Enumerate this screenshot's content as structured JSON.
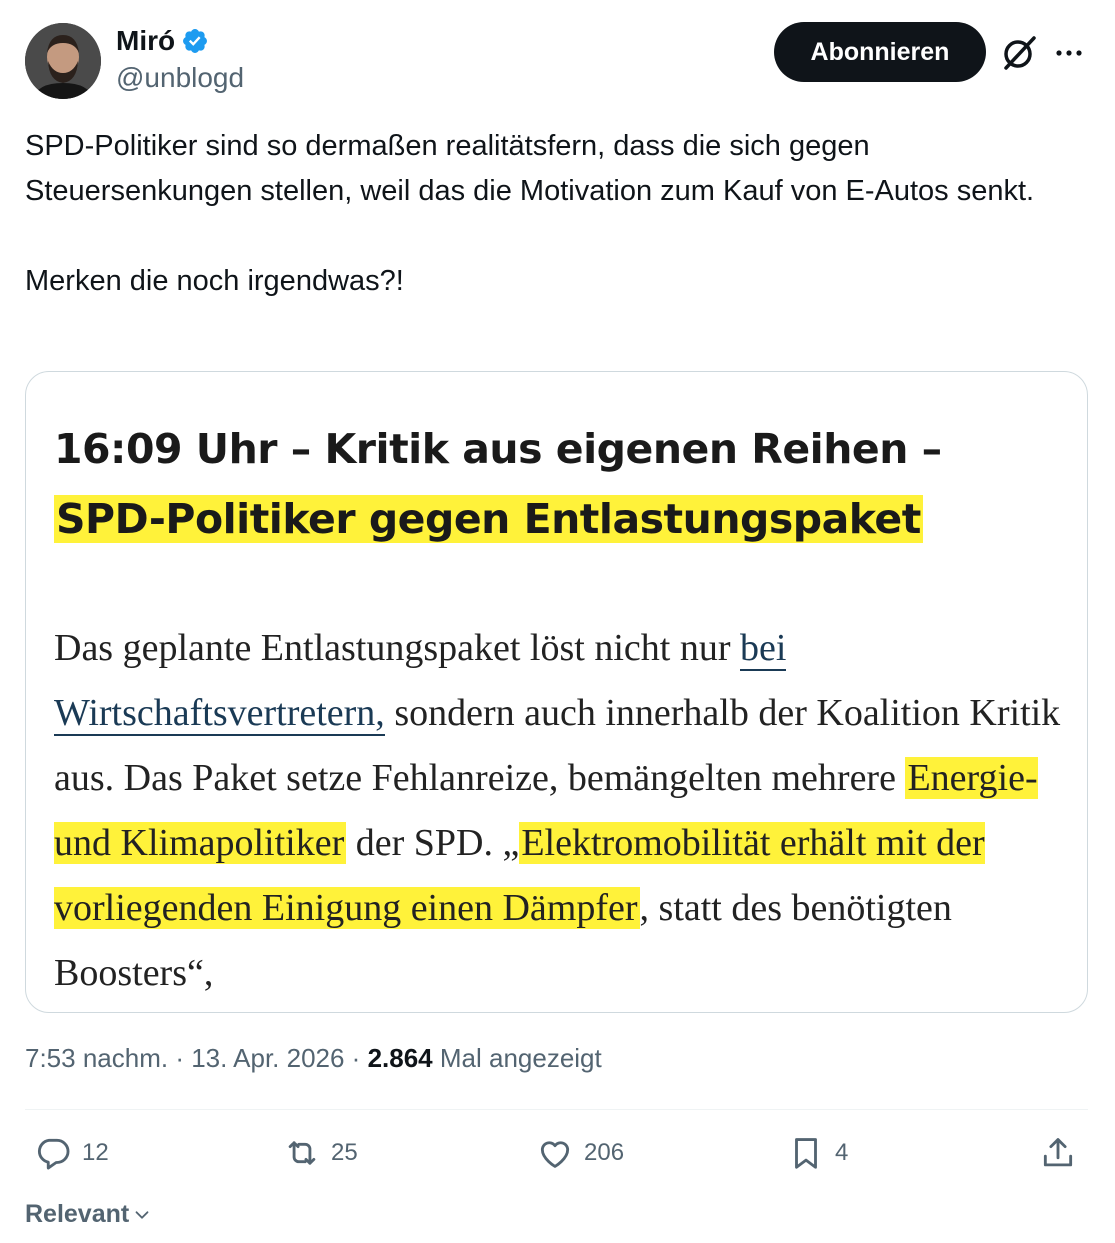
{
  "author": {
    "display_name": "Miró",
    "handle": "@unblogd",
    "verified_icon": "verified-badge-icon",
    "avatar_icon": "avatar"
  },
  "header": {
    "follow_label": "Abonnieren",
    "grok_icon": "grok-icon",
    "more_icon": "more-icon"
  },
  "tweet": {
    "text": "SPD-Politiker sind so dermaßen realitätsfern, dass die sich gegen Steuersenkungen stellen, weil das die Motivation zum Kauf von E-Autos senkt.\n\nMerken die noch irgendwas?!"
  },
  "media": {
    "headline_line1": "16:09 Uhr – Kritik aus eigenen Reihen –",
    "headline_line2": "SPD-Politiker gegen Entlastungspaket",
    "body": {
      "p1": "Das geplante Entlastungspaket löst nicht nur ",
      "link": "bei Wirtschaftsvertretern,",
      "p2": " sondern auch innerhalb der Koalition Kritik aus. Das Paket setze Fehlanreize, bemängelten mehrere ",
      "hl1": "Energie- und Klimapolitiker",
      "p3": " der SPD. „",
      "hl2": "Elektromobilität erhält mit der vorliegenden Einigung einen Dämpfer",
      "p4": ", statt des benötigten Boosters“,"
    },
    "highlight_color": "#fff23a"
  },
  "meta": {
    "time": "7:53 nachm.",
    "sep1": " · ",
    "date": "13. Apr. 2026",
    "sep2": " · ",
    "views_count": "2.864",
    "views_label": " Mal angezeigt"
  },
  "actions": {
    "replies": "12",
    "reposts": "25",
    "likes": "206",
    "bookmarks": "4"
  },
  "sort": {
    "label": "Relevant"
  },
  "colors": {
    "follow_bg": "#0f1419",
    "verified": "#1d9bf0",
    "secondary_text": "#536471"
  }
}
